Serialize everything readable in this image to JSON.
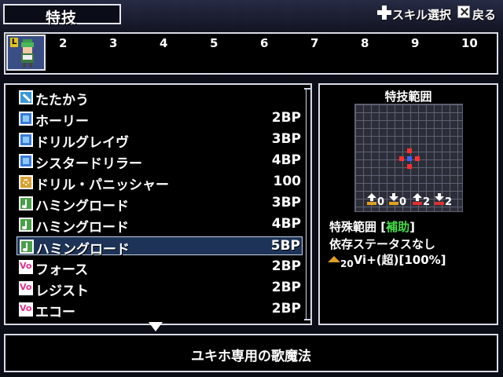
{
  "header": {
    "title": "特技",
    "skill_select_hint": "スキル選択",
    "back_hint": "戻る"
  },
  "party": {
    "slots": [
      "2",
      "3",
      "4",
      "5",
      "6",
      "7",
      "8",
      "9",
      "10"
    ]
  },
  "skills": [
    {
      "name": "たたかう",
      "cost": "",
      "icon": "attack-icon",
      "color": "#3a9ad8"
    },
    {
      "name": "ホーリー",
      "cost": "2BP",
      "icon": "blue-square-icon",
      "color": "#3a7ad8"
    },
    {
      "name": "ドリルグレイヴ",
      "cost": "3BP",
      "icon": "blue-square-icon",
      "color": "#3a7ad8"
    },
    {
      "name": "シスタードリラー",
      "cost": "4BP",
      "icon": "blue-square-icon",
      "color": "#3a7ad8"
    },
    {
      "name": "ドリル・パニッシャー",
      "cost": "100",
      "icon": "gear-icon",
      "color": "#d8a030"
    },
    {
      "name": "ハミングロード",
      "cost": "3BP",
      "icon": "music-note-icon",
      "color": "#4aa04a"
    },
    {
      "name": "ハミングロード",
      "cost": "4BP",
      "icon": "music-plus-icon",
      "color": "#4aa04a"
    },
    {
      "name": "ハミングロード",
      "cost": "5BP",
      "icon": "music-plus2-icon",
      "color": "#4aa04a"
    },
    {
      "name": "フォース",
      "cost": "2BP",
      "icon": "vo-icon",
      "color": "#e0308a"
    },
    {
      "name": "レジスト",
      "cost": "2BP",
      "icon": "vo-icon",
      "color": "#e0308a"
    },
    {
      "name": "エコー",
      "cost": "2BP",
      "icon": "vo-icon",
      "color": "#e0308a"
    }
  ],
  "selected_index": 7,
  "range_panel": {
    "title": "特技範囲",
    "stats": [
      "0",
      "0",
      "2",
      "2"
    ],
    "special_range_label": "特殊範囲 [",
    "special_range_value": "補助",
    "special_range_close": "]",
    "dependency": "依存ステータスなし",
    "effect_level": "20",
    "effect": "Vi+(超)[100%]"
  },
  "description": "ユキホ専用の歌魔法"
}
